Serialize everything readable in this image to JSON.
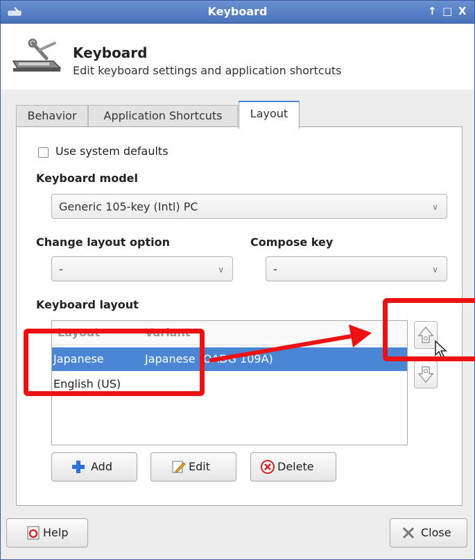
{
  "window": {
    "title": "Keyboard",
    "controls": [
      "↑",
      "□",
      "X"
    ]
  },
  "header": {
    "title": "Keyboard",
    "subtitle": "Edit keyboard settings and application shortcuts"
  },
  "tabs": [
    {
      "label": "Behavior",
      "active": false
    },
    {
      "label": "Application Shortcuts",
      "active": false
    },
    {
      "label": "Layout",
      "active": true
    }
  ],
  "layout_tab": {
    "use_system_defaults": {
      "label": "Use system defaults",
      "checked": false
    },
    "keyboard_model": {
      "heading": "Keyboard model",
      "value": "Generic 105-key (Intl) PC"
    },
    "change_layout_option": {
      "heading": "Change layout option",
      "value": "-"
    },
    "compose_key": {
      "heading": "Compose key",
      "value": "-"
    },
    "keyboard_layout": {
      "heading": "Keyboard layout",
      "columns": [
        "Layout",
        "Variant"
      ],
      "rows": [
        {
          "layout": "Japanese",
          "variant": "Japanese (OADG 109A)",
          "selected": true
        },
        {
          "layout": "English (US)",
          "variant": "",
          "selected": false
        }
      ]
    },
    "buttons": {
      "add": "Add",
      "edit": "Edit",
      "delete": "Delete"
    }
  },
  "footer": {
    "help": "Help",
    "close": "Close"
  },
  "colors": {
    "titlebar": "#4a73bc",
    "selection": "#4a86d4",
    "annotation": "#ee1111",
    "add_icon": "#2e6fd8",
    "delete_icon": "#d42020"
  },
  "icons": [
    "keyboard-settings-icon",
    "move-up-icon",
    "move-down-icon",
    "add-icon",
    "edit-icon",
    "delete-icon",
    "help-icon",
    "close-icon"
  ]
}
